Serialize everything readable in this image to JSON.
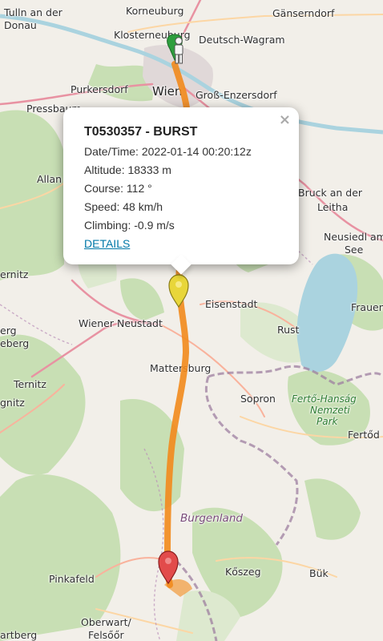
{
  "map": {
    "places": [
      {
        "id": "tulln",
        "label": "Tulln an der"
      },
      {
        "id": "donau",
        "label": "Donau"
      },
      {
        "id": "korneuburg",
        "label": "Korneuburg"
      },
      {
        "id": "gaenserndorf",
        "label": "Gänserndorf"
      },
      {
        "id": "klosterneuburg",
        "label": "Klosterneuburg"
      },
      {
        "id": "deutsch-wagram",
        "label": "Deutsch-Wagram"
      },
      {
        "id": "purkersdorf",
        "label": "Purkersdorf"
      },
      {
        "id": "wien",
        "label": "Wien"
      },
      {
        "id": "gross-enzersdorf",
        "label": "Groß-Enzersdorf"
      },
      {
        "id": "pressbaum",
        "label": "Pressbaum"
      },
      {
        "id": "allan",
        "label": "Allan"
      },
      {
        "id": "bruck",
        "label": "Bruck an der"
      },
      {
        "id": "leitha",
        "label": "Leitha"
      },
      {
        "id": "neusiedl",
        "label": "Neusiedl am"
      },
      {
        "id": "see",
        "label": "See"
      },
      {
        "id": "ernitz",
        "label": "ernitz"
      },
      {
        "id": "eisenstadt",
        "label": "Eisenstadt"
      },
      {
        "id": "frauen",
        "label": "Frauen"
      },
      {
        "id": "wiener-neustadt",
        "label": "Wiener Neustadt"
      },
      {
        "id": "rust",
        "label": "Rust"
      },
      {
        "id": "erg",
        "label": "erg"
      },
      {
        "id": "eberg",
        "label": "eberg"
      },
      {
        "id": "mattersburg",
        "label": "Mattersburg"
      },
      {
        "id": "ternitz",
        "label": "Ternitz"
      },
      {
        "id": "gnitz",
        "label": "gnitz"
      },
      {
        "id": "sopron",
        "label": "Sopron"
      },
      {
        "id": "ferto",
        "label": "Fertő-Hanság"
      },
      {
        "id": "nemzeti",
        "label": "Nemzeti"
      },
      {
        "id": "park",
        "label": "Park"
      },
      {
        "id": "fertod",
        "label": "Fertőd"
      },
      {
        "id": "burgenland",
        "label": "Burgenland"
      },
      {
        "id": "pinkafeld",
        "label": "Pinkafeld"
      },
      {
        "id": "koszeg",
        "label": "Kőszeg"
      },
      {
        "id": "buk",
        "label": "Bük"
      },
      {
        "id": "oberwart",
        "label": "Oberwart/"
      },
      {
        "id": "felsoor",
        "label": "Felsőőr"
      },
      {
        "id": "artberg",
        "label": "artberg"
      }
    ]
  },
  "popup": {
    "title": "T0530357 - BURST",
    "datetime": "Date/Time: 2022-01-14 00:20:12z",
    "altitude": "Altitude: 18333 m",
    "course": "Course: 112 °",
    "speed": "Speed: 48 km/h",
    "climbing": "Climbing: -0.9 m/s",
    "details_link": "DETAILS",
    "close_label": "×"
  },
  "markers": {
    "launch": {
      "icon": "person-icon",
      "color": "#2e9e3e"
    },
    "burst": {
      "icon": "burst-marker-icon",
      "color": "#e8d63a"
    },
    "landing": {
      "icon": "landing-marker-icon",
      "color": "#e24b4b"
    }
  },
  "track_color": "#f28a1c"
}
